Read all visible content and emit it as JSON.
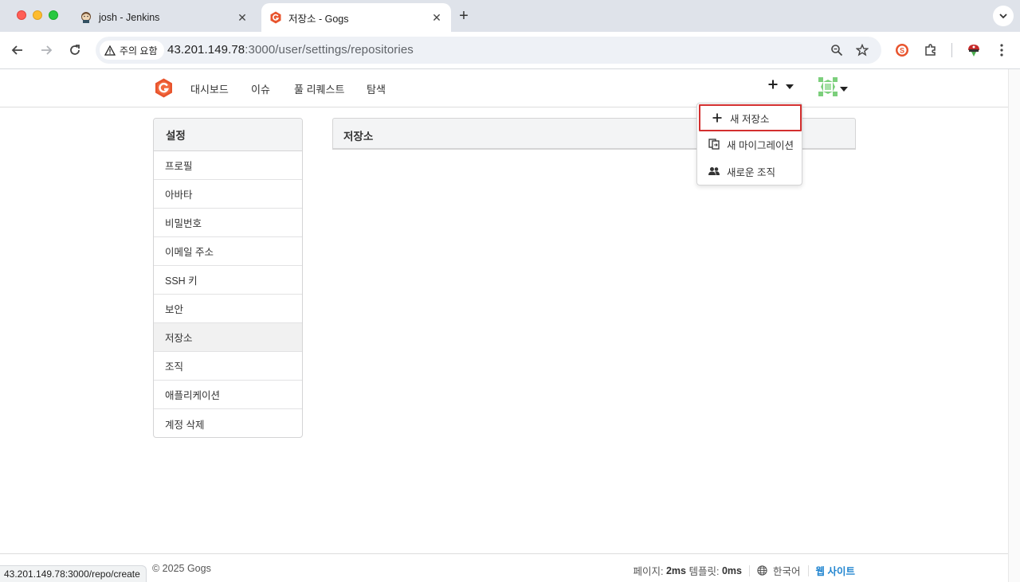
{
  "browser": {
    "tabs": [
      {
        "title": "josh - Jenkins",
        "icon": "jenkins-icon",
        "active": false
      },
      {
        "title": "저장소 - Gogs",
        "icon": "gogs-icon",
        "active": true
      }
    ],
    "security_label": "주의 요함",
    "url_host": "43.201.149.78",
    "url_path": ":3000/user/settings/repositories",
    "status_url": "43.201.149.78:3000/repo/create"
  },
  "header": {
    "nav": [
      "대시보드",
      "이슈",
      "풀 리퀘스트",
      "탐색"
    ]
  },
  "create_dropdown": {
    "items": [
      {
        "label": "새 저장소",
        "icon": "plus-icon"
      },
      {
        "label": "새 마이그레이션",
        "icon": "migration-icon"
      },
      {
        "label": "새로운 조직",
        "icon": "organization-icon"
      }
    ]
  },
  "sidebar": {
    "title": "설정",
    "items": [
      "프로필",
      "아바타",
      "비밀번호",
      "이메일 주소",
      "SSH 키",
      "보안",
      "저장소",
      "조직",
      "애플리케이션",
      "계정 삭제"
    ],
    "active": "저장소"
  },
  "main": {
    "title": "저장소"
  },
  "footer": {
    "copyright": "© 2025 Gogs",
    "page_label": "페이지:",
    "page_time": "2ms",
    "template_label": "템플릿:",
    "template_time": "0ms",
    "language": "한국어",
    "website": "웹 사이트"
  },
  "colors": {
    "gogs_brand": "#e8542d",
    "highlight_border": "#d32f2f",
    "link": "#2185d0"
  }
}
